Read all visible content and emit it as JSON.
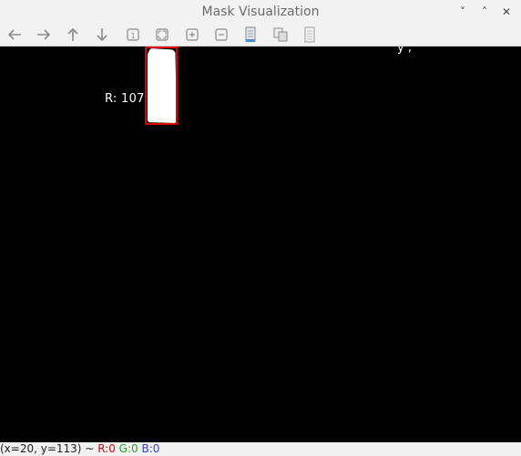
{
  "window": {
    "title": "Mask Visualization"
  },
  "window_controls": {
    "minimize_glyph": "˅",
    "maximize_glyph": "˄",
    "close_glyph": "✕"
  },
  "toolbar": {
    "buttons": [
      {
        "name": "back-arrow-icon"
      },
      {
        "name": "forward-arrow-icon"
      },
      {
        "name": "up-arrow-icon"
      },
      {
        "name": "down-arrow-icon"
      },
      {
        "name": "zoom-original-icon"
      },
      {
        "name": "zoom-fit-icon"
      },
      {
        "name": "zoom-in-icon"
      },
      {
        "name": "zoom-out-icon"
      },
      {
        "name": "save-image-icon"
      },
      {
        "name": "copy-to-clipboard-icon"
      },
      {
        "name": "properties-icon"
      }
    ]
  },
  "canvas": {
    "background": "#000000",
    "r_label": "R: 107",
    "corner_text": "y ,",
    "bbox_color": "#e00000",
    "mask_color": "#ffffff"
  },
  "status": {
    "coords": "(x=20, y=113) ~",
    "r": "R:0",
    "g": "G:0",
    "b": "B:0"
  }
}
